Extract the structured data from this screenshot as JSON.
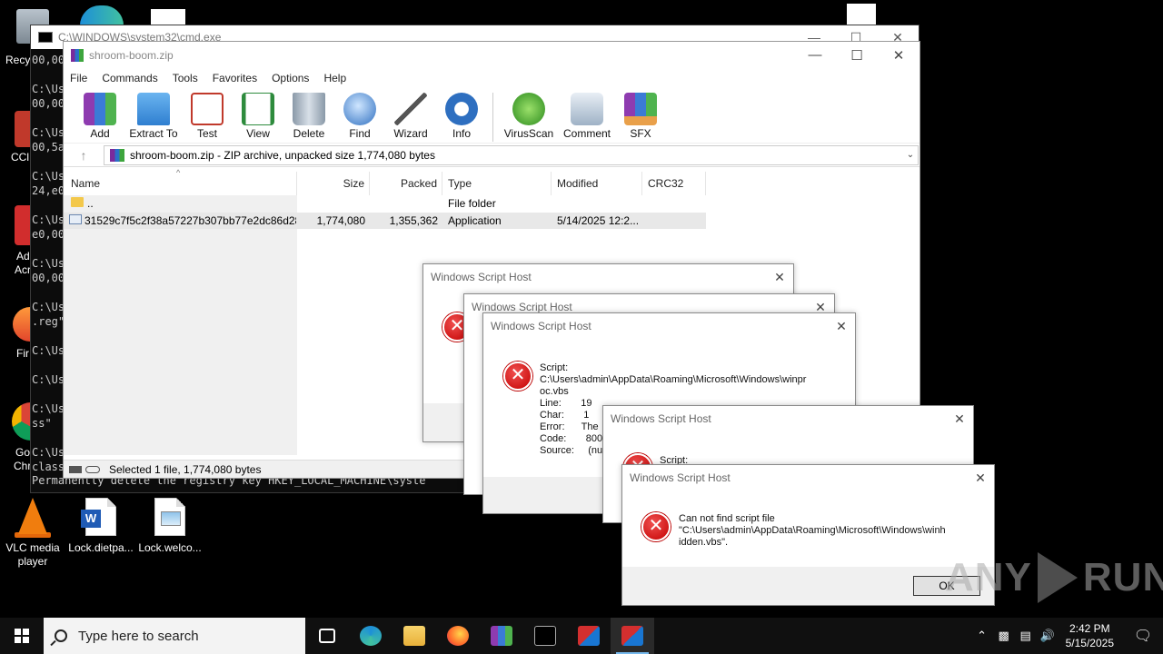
{
  "desktop": {
    "icons": [
      {
        "label_line1": "VLC media",
        "label_line2": "player"
      },
      {
        "label_line1": "Lock.dietpa...",
        "label_line2": ""
      },
      {
        "label_line1": "Lock.welco...",
        "label_line2": ""
      }
    ],
    "fragments": [
      "Recy",
      "CCl",
      "Ad",
      "Acr",
      "Fir",
      "Go",
      "Chr"
    ]
  },
  "cmd": {
    "title": "C:\\WINDOWS\\system32\\cmd.exe",
    "lines": [
      "00,00",
      "",
      "C:\\Us",
      "00,00",
      "",
      "C:\\Us",
      "00,5a",
      "",
      "C:\\Us",
      "24,e0",
      "",
      "C:\\Us",
      "e0,00",
      "",
      "C:\\Us",
      "00,00",
      "",
      "C:\\Us",
      ".reg\"",
      "",
      "C:\\Us",
      "",
      "C:\\Us",
      "",
      "C:\\Us",
      "ss\"",
      "",
      "C:\\Us",
      "class"
    ],
    "bottom_line": "Permanently delete the registry key HKEY_LOCAL_MACHINE\\syste"
  },
  "winrar": {
    "title": "shroom-boom.zip",
    "menu": [
      "File",
      "Commands",
      "Tools",
      "Favorites",
      "Options",
      "Help"
    ],
    "toolbar": [
      "Add",
      "Extract To",
      "Test",
      "View",
      "Delete",
      "Find",
      "Wizard",
      "Info",
      "VirusScan",
      "Comment",
      "SFX"
    ],
    "address": "shroom-boom.zip - ZIP archive, unpacked size 1,774,080 bytes",
    "columns": [
      "Name",
      "Size",
      "Packed",
      "Type",
      "Modified",
      "CRC32"
    ],
    "rows": [
      {
        "name": "..",
        "size": "",
        "packed": "",
        "type": "File folder",
        "modified": "",
        "crc": ""
      },
      {
        "name": "31529c7f5c2f38a57227b307bb77e2dc86d28...",
        "size": "1,774,080",
        "packed": "1,355,362",
        "type": "Application",
        "modified": "5/14/2025 12:2...",
        "crc": ""
      }
    ],
    "status": "Selected 1 file, 1,774,080 bytes"
  },
  "dialogs": {
    "title": "Windows Script Host",
    "d3_text": "Script:\nC:\\Users\\admin\\AppData\\Roaming\\Microsoft\\Windows\\winpr\noc.vbs\nLine:       19\nChar:       1\nError:      The\nCode:       800\nSource:     (null",
    "d4_text": "Script:",
    "d5_text": "Can not find script file\n\"C:\\Users\\admin\\AppData\\Roaming\\Microsoft\\Windows\\winh\nidden.vbs\".",
    "ok": "OK"
  },
  "watermark": {
    "left": "ANY",
    "right": "RUN"
  },
  "taskbar": {
    "search_placeholder": "Type here to search",
    "time": "2:42 PM",
    "date": "5/15/2025"
  }
}
